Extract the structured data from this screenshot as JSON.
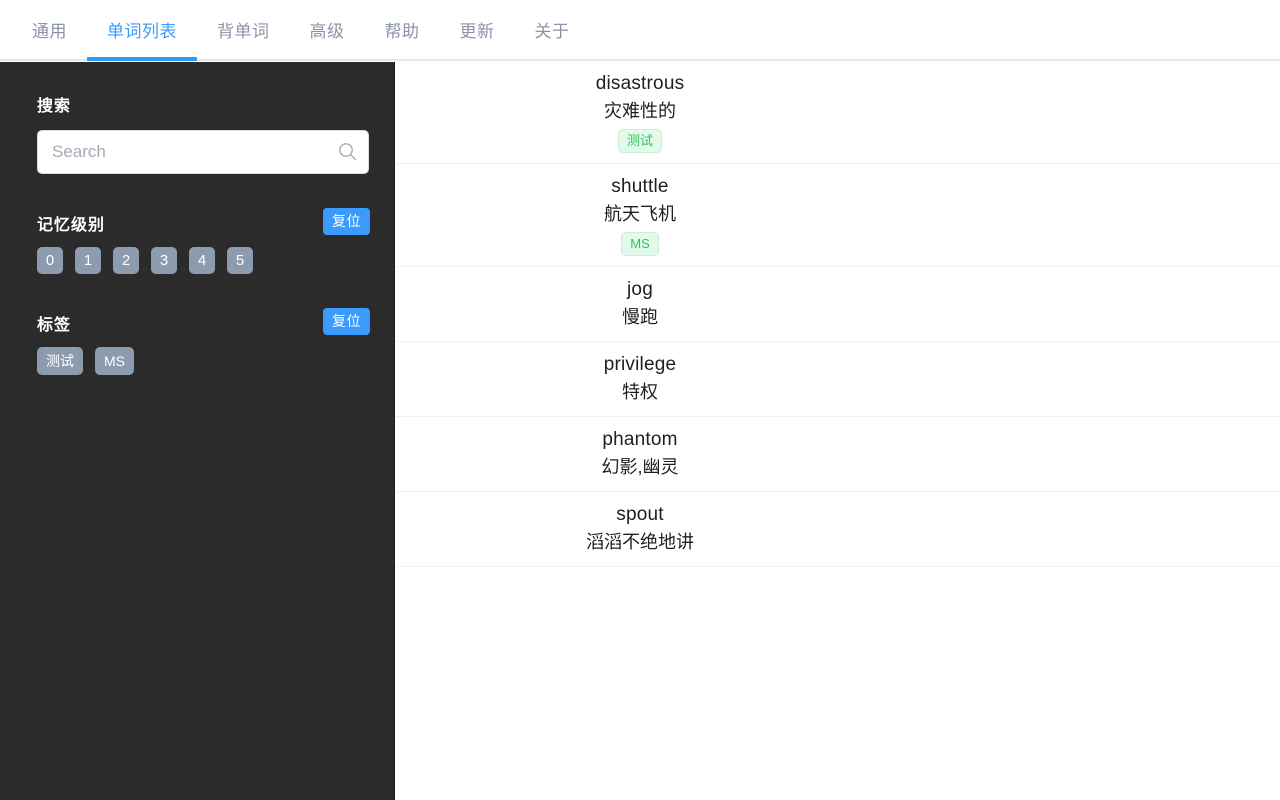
{
  "tabs": [
    {
      "label": "通用",
      "active": false
    },
    {
      "label": "单词列表",
      "active": true
    },
    {
      "label": "背单词",
      "active": false
    },
    {
      "label": "高级",
      "active": false
    },
    {
      "label": "帮助",
      "active": false
    },
    {
      "label": "更新",
      "active": false
    },
    {
      "label": "关于",
      "active": false
    }
  ],
  "sidebar": {
    "search": {
      "label": "搜索",
      "placeholder": "Search",
      "value": "",
      "icon": "search-icon"
    },
    "memory_level": {
      "label": "记忆级别",
      "reset_label": "复位",
      "levels": [
        "0",
        "1",
        "2",
        "3",
        "4",
        "5"
      ]
    },
    "tags": {
      "label": "标签",
      "reset_label": "复位",
      "items": [
        "测试",
        "MS"
      ]
    }
  },
  "wordlist": [
    {
      "term": "disastrous",
      "definition": "灾难性的",
      "tags": [
        "测试"
      ]
    },
    {
      "term": "shuttle",
      "definition": "航天飞机",
      "tags": [
        "MS"
      ]
    },
    {
      "term": "jog",
      "definition": "慢跑",
      "tags": []
    },
    {
      "term": "privilege",
      "definition": "特权",
      "tags": []
    },
    {
      "term": "phantom",
      "definition": "幻影,幽灵",
      "tags": []
    },
    {
      "term": "spout",
      "definition": "滔滔不绝地讲",
      "tags": []
    }
  ],
  "colors": {
    "accent": "#3a9bfc",
    "sidebar_bg": "#2b2b2b",
    "chip": "#8c9bad",
    "badge_text": "#35c05f",
    "badge_bg": "#e3f9ea",
    "tab_inactive": "#8a94a6"
  }
}
